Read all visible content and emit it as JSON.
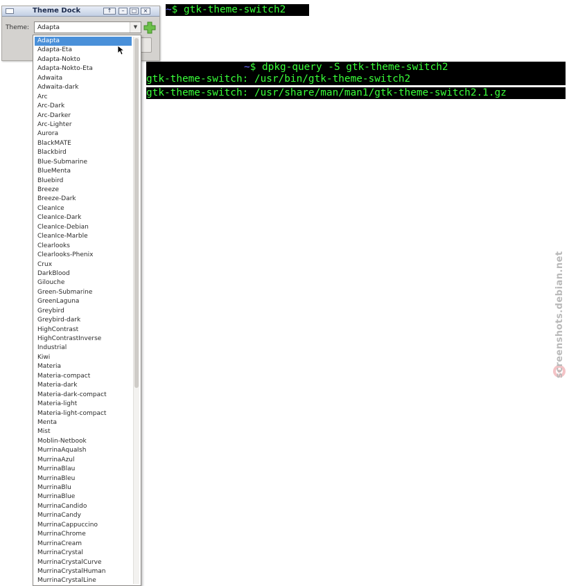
{
  "dock": {
    "title": "Theme Dock",
    "titlebar_buttons": [
      "↑",
      "–",
      "□",
      "×"
    ],
    "theme_label": "Theme:",
    "selected_theme": "Adapta"
  },
  "theme_list": [
    "Adapta",
    "Adapta-Eta",
    "Adapta-Nokto",
    "Adapta-Nokto-Eta",
    "Adwaita",
    "Adwaita-dark",
    "Arc",
    "Arc-Dark",
    "Arc-Darker",
    "Arc-Lighter",
    "Aurora",
    "BlackMATE",
    "Blackbird",
    "Blue-Submarine",
    "BlueMenta",
    "Bluebird",
    "Breeze",
    "Breeze-Dark",
    "CleanIce",
    "CleanIce-Dark",
    "CleanIce-Debian",
    "CleanIce-Marble",
    "Clearlooks",
    "Clearlooks-Phenix",
    "Crux",
    "DarkBlood",
    "Gilouche",
    "Green-Submarine",
    "GreenLaguna",
    "Greybird",
    "Greybird-dark",
    "HighContrast",
    "HighContrastInverse",
    "Industrial",
    "Kiwi",
    "Materia",
    "Materia-compact",
    "Materia-dark",
    "Materia-dark-compact",
    "Materia-light",
    "Materia-light-compact",
    "Menta",
    "Mist",
    "Moblin-Netbook",
    "MurrinaAquaIsh",
    "MurrinaAzul",
    "MurrinaBlau",
    "MurrinaBleu",
    "MurrinaBlu",
    "MurrinaBlue",
    "MurrinaCandido",
    "MurrinaCandy",
    "MurrinaCappuccino",
    "MurrinaChrome",
    "MurrinaCream",
    "MurrinaCrystal",
    "MurrinaCrystalCurve",
    "MurrinaCrystalHuman",
    "MurrinaCrystalLine"
  ],
  "terminal": {
    "prompt_symbol": "~",
    "line1": "$ gtk-theme-switch2",
    "line2": "$ dpkg-query -S gtk-theme-switch2",
    "line3": "gtk-theme-switch: /usr/bin/gtk-theme-switch2",
    "line4": "gtk-theme-switch: /usr/share/man/man1/gtk-theme-switch2.1.gz"
  },
  "watermark": "screenshots.debian.net",
  "colors": {
    "selection": "#4a90d9",
    "terminal_text": "#39ff39",
    "terminal_bg": "#000000"
  }
}
